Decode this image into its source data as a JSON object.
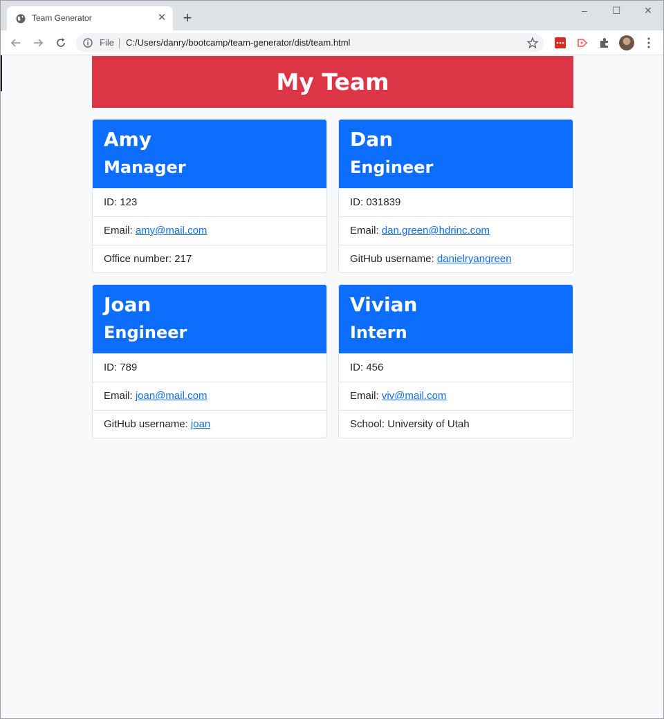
{
  "browser": {
    "tab_title": "Team Generator",
    "url_scheme": "File",
    "url": "C:/Users/danry/bootcamp/team-generator/dist/team.html"
  },
  "page": {
    "title": "My Team"
  },
  "colors": {
    "header": "#dc3545",
    "card_header": "#0d6efd",
    "link": "#0d6efd"
  },
  "team": [
    {
      "name": "Amy",
      "role": "Manager",
      "id_label": "ID: 123",
      "email_label": "Email: ",
      "email": "amy@mail.com",
      "extra_label": "Office number: 217",
      "extra_link": ""
    },
    {
      "name": "Dan",
      "role": "Engineer",
      "id_label": "ID: 031839",
      "email_label": "Email: ",
      "email": "dan.green@hdrinc.com",
      "extra_label": "GitHub username: ",
      "extra_link": "danielryangreen"
    },
    {
      "name": "Joan",
      "role": "Engineer",
      "id_label": "ID: 789",
      "email_label": "Email: ",
      "email": "joan@mail.com",
      "extra_label": "GitHub username: ",
      "extra_link": "joan"
    },
    {
      "name": "Vivian",
      "role": "Intern",
      "id_label": "ID: 456",
      "email_label": "Email: ",
      "email": "viv@mail.com",
      "extra_label": "School: University of Utah",
      "extra_link": ""
    }
  ]
}
